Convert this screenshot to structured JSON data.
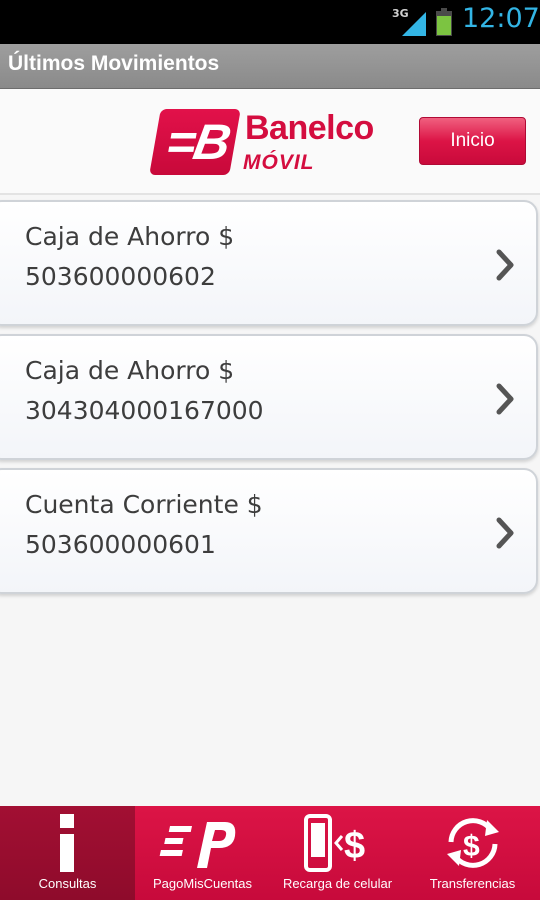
{
  "status_bar": {
    "network": "3G",
    "time": "12:07"
  },
  "title_bar": {
    "title": "Últimos Movimientos"
  },
  "header": {
    "logo_mark": "=B",
    "logo_name": "Banelco",
    "logo_sub": "MÓVIL",
    "inicio_label": "Inicio"
  },
  "accounts": [
    {
      "type": "Caja de Ahorro $",
      "number": "503600000602"
    },
    {
      "type": "Caja de Ahorro $",
      "number": "304304000167000"
    },
    {
      "type": "Cuenta Corriente $",
      "number": "503600000601"
    }
  ],
  "bottom_nav": {
    "items": [
      {
        "label": "Consultas",
        "icon": "info-icon",
        "active": true
      },
      {
        "label": "PagoMisCuentas",
        "icon": "pagomiscuentas-icon",
        "active": false
      },
      {
        "label": "Recarga de celular",
        "icon": "phone-recharge-icon",
        "active": false
      },
      {
        "label": "Transferencias",
        "icon": "transfer-icon",
        "active": false
      }
    ]
  },
  "colors": {
    "brand_red": "#d40d3f",
    "nav_active": "#9a0e30",
    "clock_blue": "#33b5e5"
  }
}
